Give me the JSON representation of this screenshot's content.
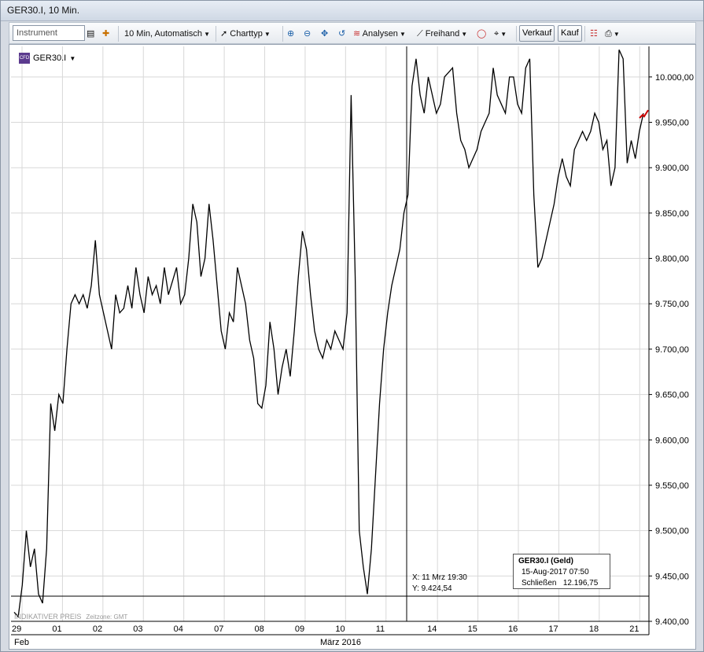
{
  "window": {
    "title": "GER30.I, 10 Min."
  },
  "toolbar": {
    "instrument_placeholder": "Instrument",
    "interval": "10 Min,  Automatisch",
    "charttype": "Charttyp",
    "analysen": "Analysen",
    "freihand": "Freihand",
    "verkauf": "Verkauf",
    "kauf": "Kauf"
  },
  "legend": {
    "instrument": "GER30.I",
    "icon": "cfd-icon"
  },
  "crosshair": {
    "x_label": "X: 11 Mrz 19:30",
    "y_label": "Y: 9.424,54"
  },
  "infobox": {
    "title": "GER30.I (Geld)",
    "date": "15-Aug-2017 07:50",
    "label": "Schließen",
    "value": "12.196,75"
  },
  "watermark": {
    "text": "INDIKATIVER PREIS",
    "tz": "Zeitzone: GMT"
  },
  "colors": {
    "line": "#000000",
    "grid": "#d8d8d8",
    "accent_last": "#cc0000"
  },
  "chart_data": {
    "type": "line",
    "title": "",
    "xlabel": "",
    "ylabel": "",
    "x_tick_labels": [
      "29",
      "01",
      "02",
      "03",
      "04",
      "07",
      "08",
      "09",
      "10",
      "11",
      "14",
      "15",
      "16",
      "17",
      "18",
      "21"
    ],
    "x_group_labels": [
      "Feb",
      "März 2016"
    ],
    "y_tick_labels": [
      "10.000,00",
      "9.950,00",
      "9.900,00",
      "9.850,00",
      "9.800,00",
      "9.750,00",
      "9.700,00",
      "9.650,00",
      "9.600,00",
      "9.550,00",
      "9.500,00",
      "9.450,00",
      "9.400,00"
    ],
    "ylim": [
      9400,
      10025
    ],
    "grid": true,
    "series": [
      {
        "values": [
          9410,
          9405,
          9440,
          9500,
          9460,
          9480,
          9430,
          9420,
          9480,
          9640,
          9610,
          9650,
          9640,
          9700,
          9750,
          9760,
          9750,
          9760,
          9745,
          9770,
          9820,
          9760,
          9740,
          9720,
          9700,
          9760,
          9740,
          9745,
          9770,
          9745,
          9790,
          9760,
          9740,
          9780,
          9760,
          9770,
          9750,
          9790,
          9760,
          9775,
          9790,
          9750,
          9760,
          9800,
          9860,
          9840,
          9780,
          9800,
          9860,
          9820,
          9770,
          9720,
          9700,
          9740,
          9730,
          9790,
          9770,
          9750,
          9710,
          9690,
          9640,
          9635,
          9660,
          9730,
          9700,
          9650,
          9680,
          9700,
          9670,
          9720,
          9780,
          9830,
          9810,
          9760,
          9720,
          9700,
          9690,
          9710,
          9700,
          9720,
          9710,
          9700,
          9740,
          9980,
          9780,
          9500,
          9460,
          9430,
          9480,
          9560,
          9640,
          9700,
          9740,
          9770,
          9790,
          9810,
          9850,
          9870,
          9990,
          10020,
          9980,
          9960,
          10000,
          9980,
          9960,
          9970,
          10000,
          10005,
          10010,
          9960,
          9930,
          9920,
          9900,
          9910,
          9920,
          9940,
          9950,
          9960,
          10010,
          9980,
          9970,
          9960,
          10000,
          10000,
          9970,
          9960,
          10010,
          10020,
          9870,
          9790,
          9800,
          9820,
          9840,
          9860,
          9890,
          9910,
          9890,
          9880,
          9920,
          9930,
          9940,
          9930,
          9940,
          9960,
          9950,
          9920,
          9930,
          9880,
          9900,
          10030,
          10020,
          9905,
          9930,
          9910,
          9940,
          9960
        ]
      }
    ]
  }
}
